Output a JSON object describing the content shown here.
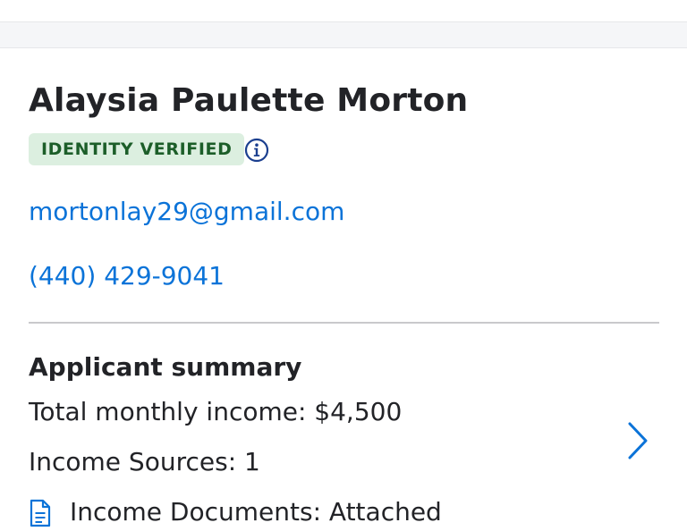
{
  "applicant": {
    "name": "Alaysia Paulette Morton",
    "badge_label": "IDENTITY VERIFIED",
    "email": "mortonlay29@gmail.com",
    "phone": "(440) 429-9041"
  },
  "summary": {
    "title": "Applicant summary",
    "income_line": "Total monthly income: $4,500",
    "sources_line": "Income Sources: 1",
    "documents_line": "Income Documents: Attached"
  },
  "icons": {
    "info": "info-circle-icon",
    "document": "document-icon",
    "chevron": "chevron-right-icon"
  },
  "colors": {
    "link": "#0b73d8",
    "badge_bg": "#dcefe0",
    "badge_text": "#1c5e29",
    "info_icon": "#1b3f8f",
    "divider": "#c9c9cc"
  }
}
